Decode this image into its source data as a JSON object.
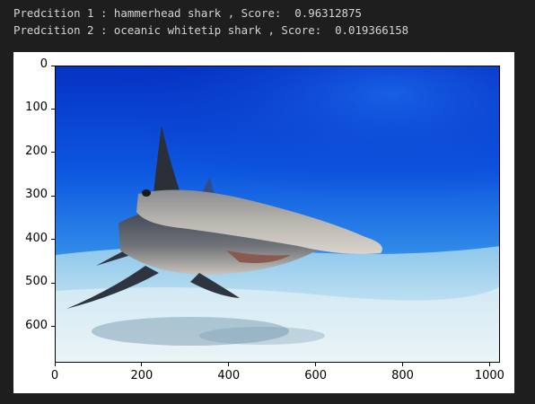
{
  "output": {
    "line1": "Predcition 1 : hammerhead shark , Score:  0.96312875",
    "line2": "Predcition 2 : oceanic whitetip shark , Score:  0.019366158"
  },
  "figure": {
    "image_subject": "hammerhead shark swimming over sandy seabed",
    "xlim": [
      0,
      1024
    ],
    "ylim": [
      683,
      0
    ],
    "x_ticks": [
      "0",
      "200",
      "400",
      "600",
      "800",
      "1000"
    ],
    "y_ticks": [
      "0",
      "100",
      "200",
      "300",
      "400",
      "500",
      "600"
    ],
    "colors": {
      "water_top": "#0a3fd6",
      "water_mid": "#1a73e8",
      "sand": "#d8ecf4",
      "shark_body": "#5a5e66",
      "shark_belly": "#c8c6c2"
    }
  }
}
